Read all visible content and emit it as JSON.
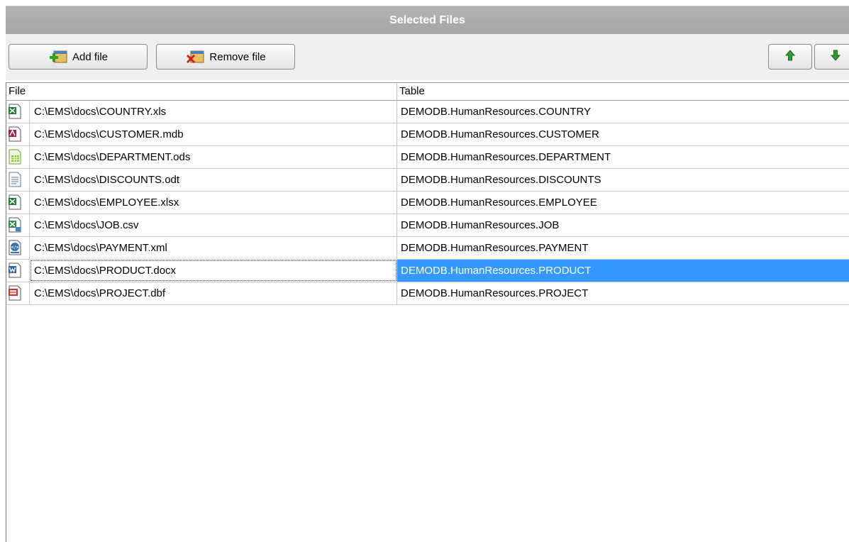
{
  "title": "Selected Files",
  "toolbar": {
    "add_label": "Add file",
    "remove_label": "Remove file"
  },
  "columns": {
    "file": "File",
    "table": "Table"
  },
  "colors": {
    "selection": "#3399ff",
    "title_bar": "#a9a9a9",
    "arrow": "#2e9e2e"
  },
  "rows": [
    {
      "icon": "excel-file-icon",
      "file": "C:\\EMS\\docs\\COUNTRY.xls",
      "table": "DEMODB.HumanResources.COUNTRY"
    },
    {
      "icon": "access-file-icon",
      "file": "C:\\EMS\\docs\\CUSTOMER.mdb",
      "table": "DEMODB.HumanResources.CUSTOMER"
    },
    {
      "icon": "ods-file-icon",
      "file": "C:\\EMS\\docs\\DEPARTMENT.ods",
      "table": "DEMODB.HumanResources.DEPARTMENT"
    },
    {
      "icon": "odt-file-icon",
      "file": "C:\\EMS\\docs\\DISCOUNTS.odt",
      "table": "DEMODB.HumanResources.DISCOUNTS"
    },
    {
      "icon": "excel-file-icon",
      "file": "C:\\EMS\\docs\\EMPLOYEE.xlsx",
      "table": "DEMODB.HumanResources.EMPLOYEE"
    },
    {
      "icon": "csv-file-icon",
      "file": "C:\\EMS\\docs\\JOB.csv",
      "table": "DEMODB.HumanResources.JOB"
    },
    {
      "icon": "xml-file-icon",
      "file": "C:\\EMS\\docs\\PAYMENT.xml",
      "table": "DEMODB.HumanResources.PAYMENT"
    },
    {
      "icon": "word-file-icon",
      "file": "C:\\EMS\\docs\\PRODUCT.docx",
      "table": "DEMODB.HumanResources.PRODUCT",
      "selected": true
    },
    {
      "icon": "dbf-file-icon",
      "file": "C:\\EMS\\docs\\PROJECT.dbf",
      "table": "DEMODB.HumanResources.PROJECT"
    }
  ]
}
